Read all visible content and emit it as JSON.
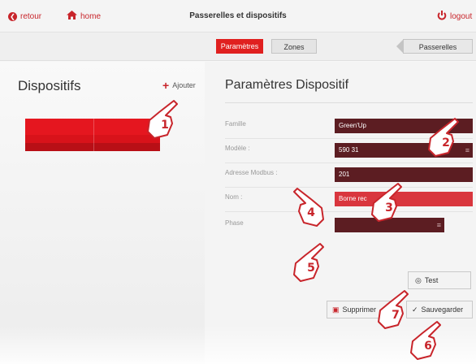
{
  "header": {
    "back_label": "retour",
    "home_label": "home",
    "title": "Passerelles et dispositifs",
    "logout_label": "logout"
  },
  "tabs": {
    "parametres": "Paramètres",
    "zones": "Zones",
    "passerelles": "Passerelles"
  },
  "left_panel": {
    "title": "Dispositifs",
    "add_label": "Ajouter"
  },
  "right_panel": {
    "title": "Paramètres Dispositif",
    "fields": {
      "famille": {
        "label": "Famille",
        "value": "Green'Up"
      },
      "modele": {
        "label": "Modèle :",
        "value": "590 31"
      },
      "adresse": {
        "label": "Adresse Modbus :",
        "value": "201"
      },
      "nom": {
        "label": "Nom :",
        "value": "Borne rec"
      },
      "phase": {
        "label": "Phase",
        "value": ""
      }
    },
    "buttons": {
      "test": "Test",
      "delete": "Supprimer",
      "save": "Sauvegarder"
    }
  },
  "callouts": [
    "1",
    "2",
    "3",
    "4",
    "5",
    "6",
    "7"
  ],
  "colors": {
    "accent": "#e0201f",
    "dark_field": "#5c1d22",
    "red_field": "#d9363e"
  }
}
